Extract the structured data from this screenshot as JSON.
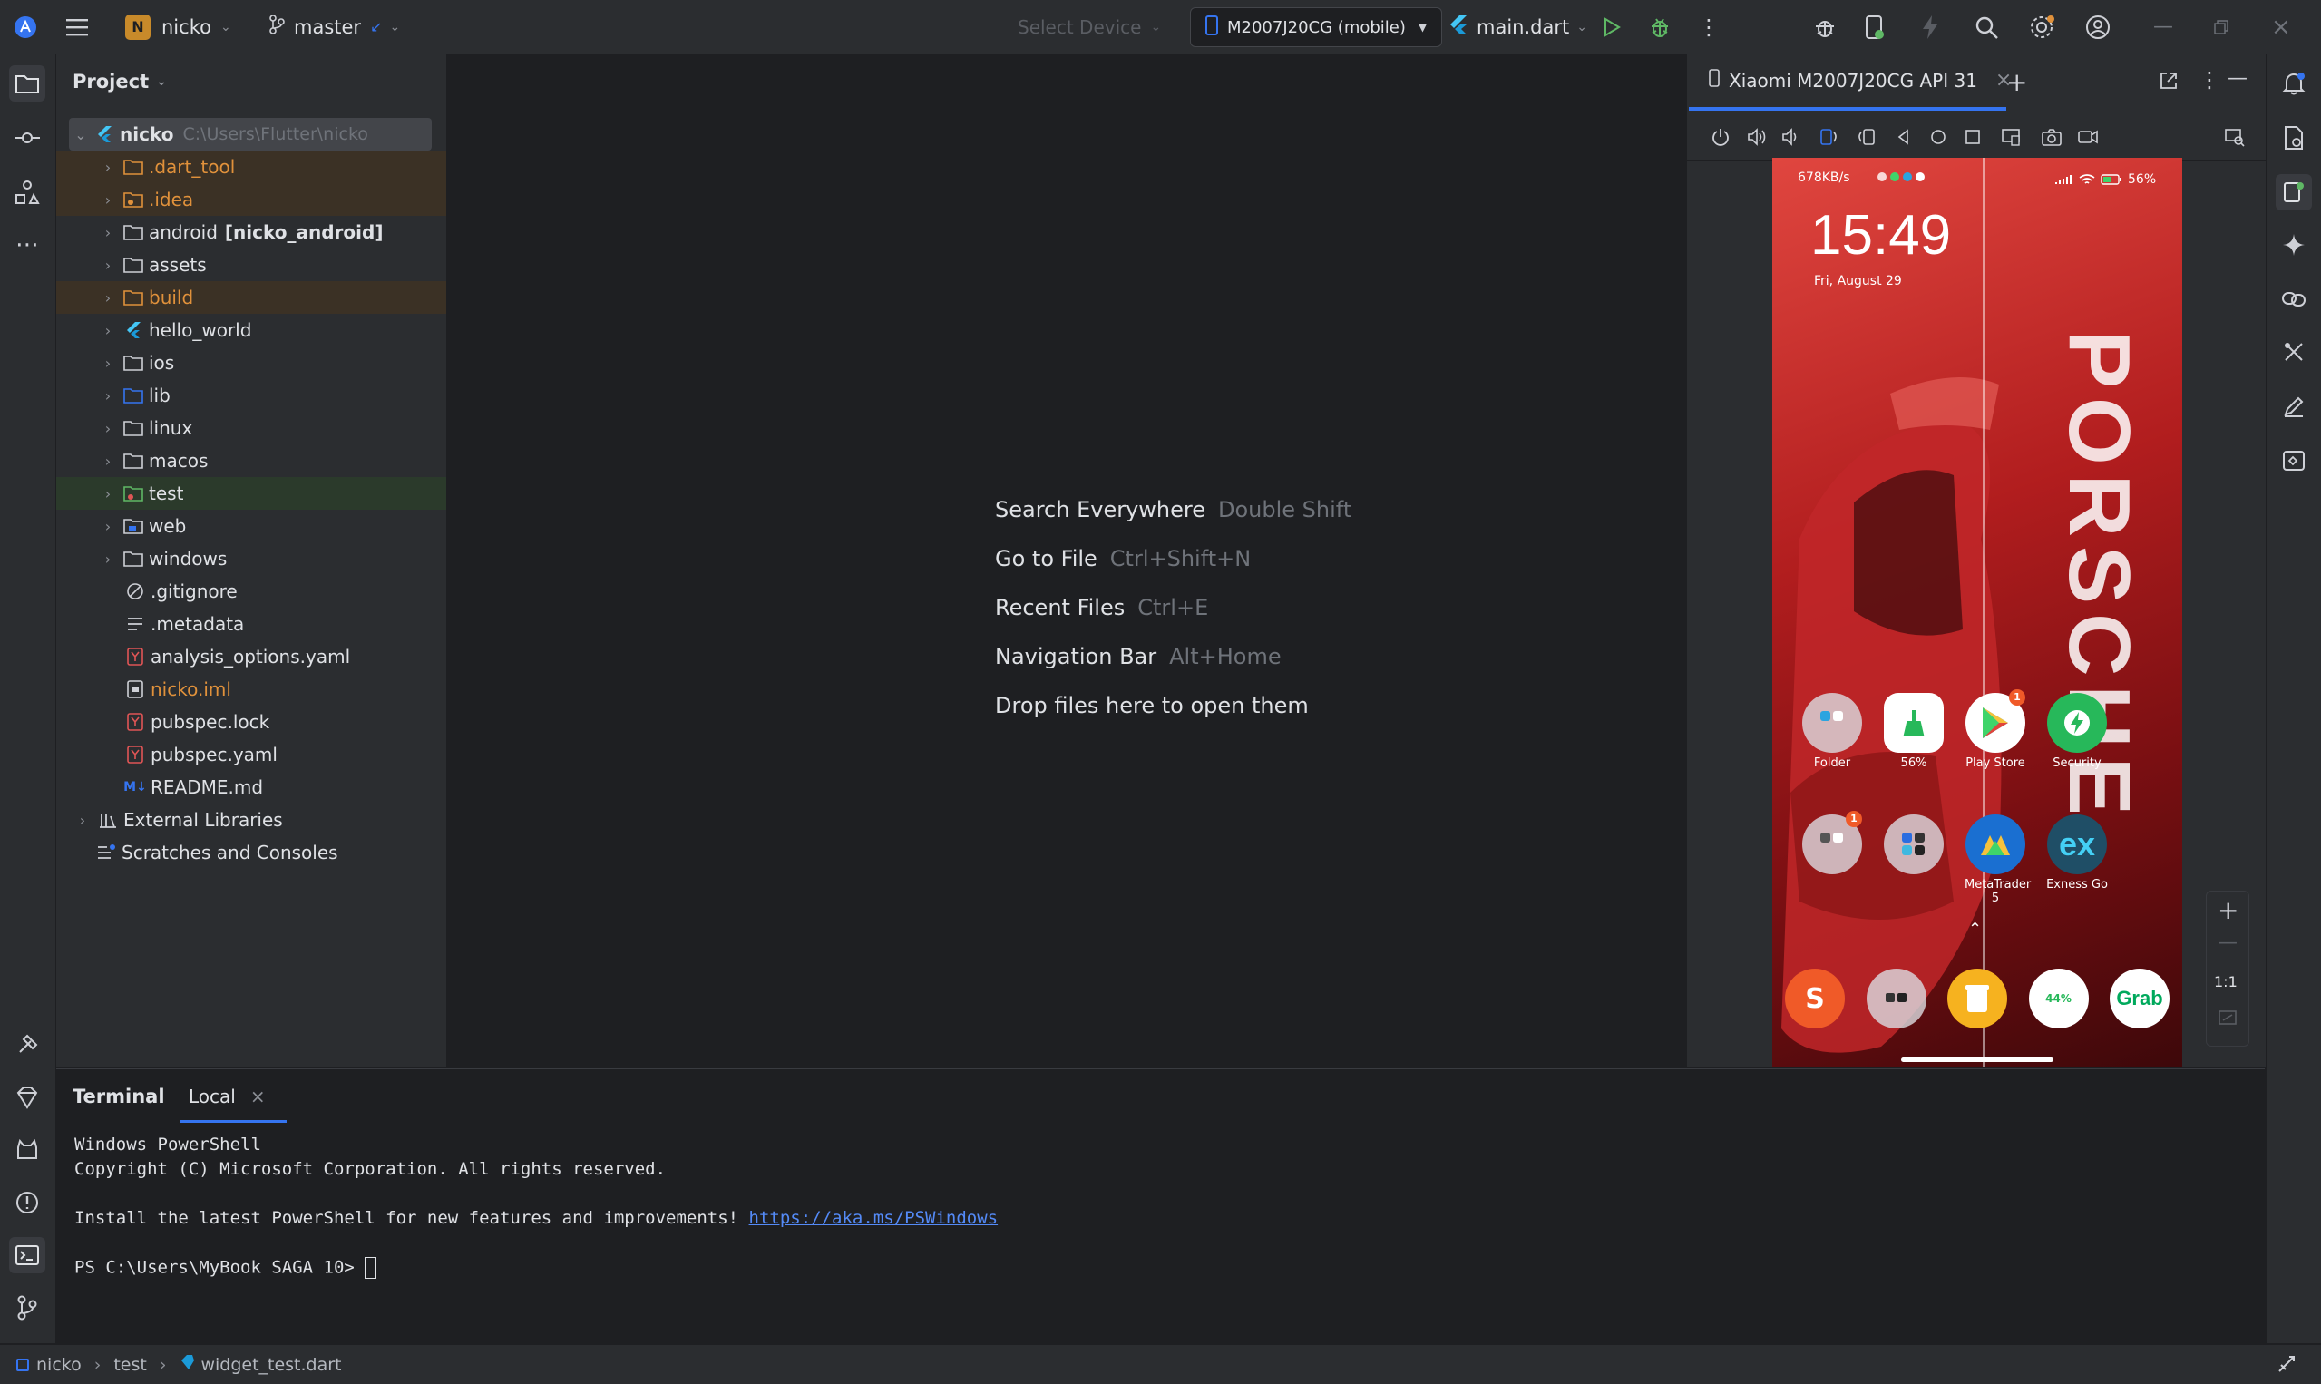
{
  "topbar": {
    "project_badge": "N",
    "project_name": "nicko",
    "branch": "master",
    "select_device": "Select Device",
    "device": "M2007J20CG (mobile)",
    "run_config": "main.dart"
  },
  "project_panel": {
    "title": "Project",
    "root": {
      "name": "nicko",
      "path": "C:\\Users\\Flutter\\nicko"
    },
    "items": [
      {
        "label": ".dart_tool"
      },
      {
        "label": ".idea"
      },
      {
        "label": "android",
        "suffix": "[nicko_android]"
      },
      {
        "label": "assets"
      },
      {
        "label": "build"
      },
      {
        "label": "hello_world"
      },
      {
        "label": "ios"
      },
      {
        "label": "lib"
      },
      {
        "label": "linux"
      },
      {
        "label": "macos"
      },
      {
        "label": "test"
      },
      {
        "label": "web"
      },
      {
        "label": "windows"
      },
      {
        "label": ".gitignore"
      },
      {
        "label": ".metadata"
      },
      {
        "label": "analysis_options.yaml"
      },
      {
        "label": "nicko.iml"
      },
      {
        "label": "pubspec.lock"
      },
      {
        "label": "pubspec.yaml"
      },
      {
        "label": "README.md"
      },
      {
        "label": "External Libraries"
      },
      {
        "label": "Scratches and Consoles"
      }
    ]
  },
  "editor_hints": [
    {
      "label": "Search Everywhere",
      "shortcut": "Double Shift"
    },
    {
      "label": "Go to File",
      "shortcut": "Ctrl+Shift+N"
    },
    {
      "label": "Recent Files",
      "shortcut": "Ctrl+E"
    },
    {
      "label": "Navigation Bar",
      "shortcut": "Alt+Home"
    },
    {
      "label": "Drop files here to open them",
      "shortcut": ""
    }
  ],
  "emulator": {
    "tab_title": "Xiaomi M2007J20CG API 31",
    "zoom_label": "1:1",
    "phone": {
      "status_left": "678KB/s",
      "battery": "56%",
      "time": "15:49",
      "date": "Fri, August 29",
      "wallpaper_text": "PORSCHE",
      "apps": [
        {
          "label": "Folder"
        },
        {
          "label": "56%"
        },
        {
          "label": "Play Store",
          "badge": "1"
        },
        {
          "label": "Security"
        },
        {
          "label": "",
          "badge": "1"
        },
        {
          "label": ""
        },
        {
          "label": "MetaTrader 5"
        },
        {
          "label": "Exness Go",
          "icon_text": "ex"
        }
      ],
      "dock": [
        {
          "icon_text": "S"
        },
        {
          "icon_text": ""
        },
        {
          "icon_text": ""
        },
        {
          "icon_text": "44%"
        },
        {
          "icon_text": "Grab"
        }
      ]
    }
  },
  "terminal": {
    "title": "Terminal",
    "tab": "Local",
    "lines": [
      "Windows PowerShell",
      "Copyright (C) Microsoft Corporation. All rights reserved.",
      "",
      "Install the latest PowerShell for new features and improvements! "
    ],
    "link": "https://aka.ms/PSWindows",
    "prompt": "PS C:\\Users\\MyBook SAGA 10> "
  },
  "statusbar": {
    "crumbs": [
      "nicko",
      "test",
      "widget_test.dart"
    ]
  },
  "colors": {
    "accent": "#3574f0",
    "folder_excluded_bg": "#3b3125",
    "test_bg": "#2b3a2b",
    "run_green": "#5fb865",
    "orange": "#e0913b"
  }
}
